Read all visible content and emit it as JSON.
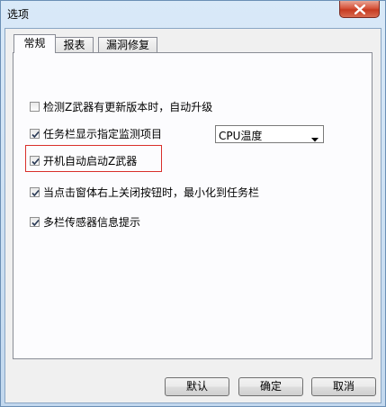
{
  "window": {
    "title": "选项"
  },
  "tabs": [
    {
      "label": "常规",
      "active": true
    },
    {
      "label": "报表",
      "active": false
    },
    {
      "label": "漏洞修复",
      "active": false
    }
  ],
  "options": [
    {
      "label": "检测Z武器有更新版本时，自动升级",
      "checked": false
    },
    {
      "label": "任务栏显示指定监测项目",
      "checked": true
    },
    {
      "label": "开机自动启动Z武器",
      "checked": true
    },
    {
      "label": "当点击窗体右上关闭按钮时，最小化到任务栏",
      "checked": true
    },
    {
      "label": "多栏传感器信息提示",
      "checked": true
    }
  ],
  "monitor_select": {
    "value": "CPU温度"
  },
  "buttons": {
    "default": "默认",
    "ok": "确定",
    "cancel": "取消"
  },
  "colors": {
    "highlight": "#d9302b",
    "close": "#c63a20"
  },
  "icons": {
    "close": "close-icon",
    "dropdown": "chevron-down-icon",
    "check": "checkmark-icon"
  }
}
